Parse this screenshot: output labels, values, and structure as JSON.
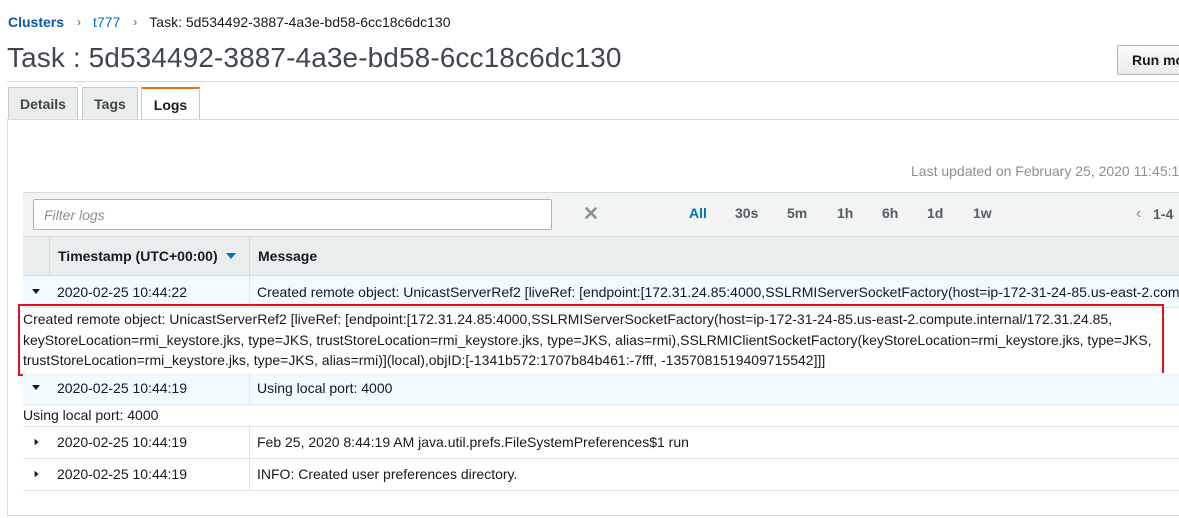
{
  "breadcrumb": {
    "clusters": "Clusters",
    "cluster": "t777",
    "current": "Task: 5d534492-3887-4a3e-bd58-6cc18c6dc130"
  },
  "page": {
    "title": "Task : 5d534492-3887-4a3e-bd58-6cc18c6dc130",
    "run_button": "Run mo"
  },
  "tabs": [
    {
      "label": "Details"
    },
    {
      "label": "Tags"
    },
    {
      "label": "Logs",
      "active": true
    }
  ],
  "logs": {
    "last_updated": "Last updated on February 25, 2020 11:45:1",
    "filter_placeholder": "Filter logs",
    "ranges": [
      "All",
      "30s",
      "5m",
      "1h",
      "6h",
      "1d",
      "1w"
    ],
    "active_range": "All",
    "pager": "1-4",
    "columns": {
      "timestamp": "Timestamp (UTC+00:00)",
      "message": "Message"
    },
    "rows": [
      {
        "timestamp": "2020-02-25 10:44:22",
        "message": "Created remote object: UnicastServerRef2 [liveRef: [endpoint:[172.31.24.85:4000,SSLRMIServerSocketFactory(host=ip-172-31-24-85.us-east-2.com",
        "expanded": true,
        "detail_lines": [
          "Created remote object: UnicastServerRef2 [liveRef: [endpoint:[172.31.24.85:4000,SSLRMIServerSocketFactory(host=ip-172-31-24-85.us-east-2.compute.internal/172.31.24.85,",
          "keyStoreLocation=rmi_keystore.jks, type=JKS, trustStoreLocation=rmi_keystore.jks, type=JKS, alias=rmi),SSLRMIClientSocketFactory(keyStoreLocation=rmi_keystore.jks, type=JKS,",
          "trustStoreLocation=rmi_keystore.jks, type=JKS, alias=rmi)](local),objID:[-1341b572:1707b84b461:-7fff, -1357081519409715542]]]"
        ]
      },
      {
        "timestamp": "2020-02-25 10:44:19",
        "message": "Using local port: 4000",
        "expanded": true,
        "detail_lines": [
          "Using local port: 4000"
        ]
      },
      {
        "timestamp": "2020-02-25 10:44:19",
        "message": "Feb 25, 2020 8:44:19 AM java.util.prefs.FileSystemPreferences$1 run",
        "expanded": false
      },
      {
        "timestamp": "2020-02-25 10:44:19",
        "message": "INFO: Created user preferences directory.",
        "expanded": false
      }
    ]
  },
  "colors": {
    "link": "#0073bb",
    "highlight_border": "#e3111b",
    "tab_accent": "#ec7211",
    "expanded_row": "#f1faff"
  }
}
